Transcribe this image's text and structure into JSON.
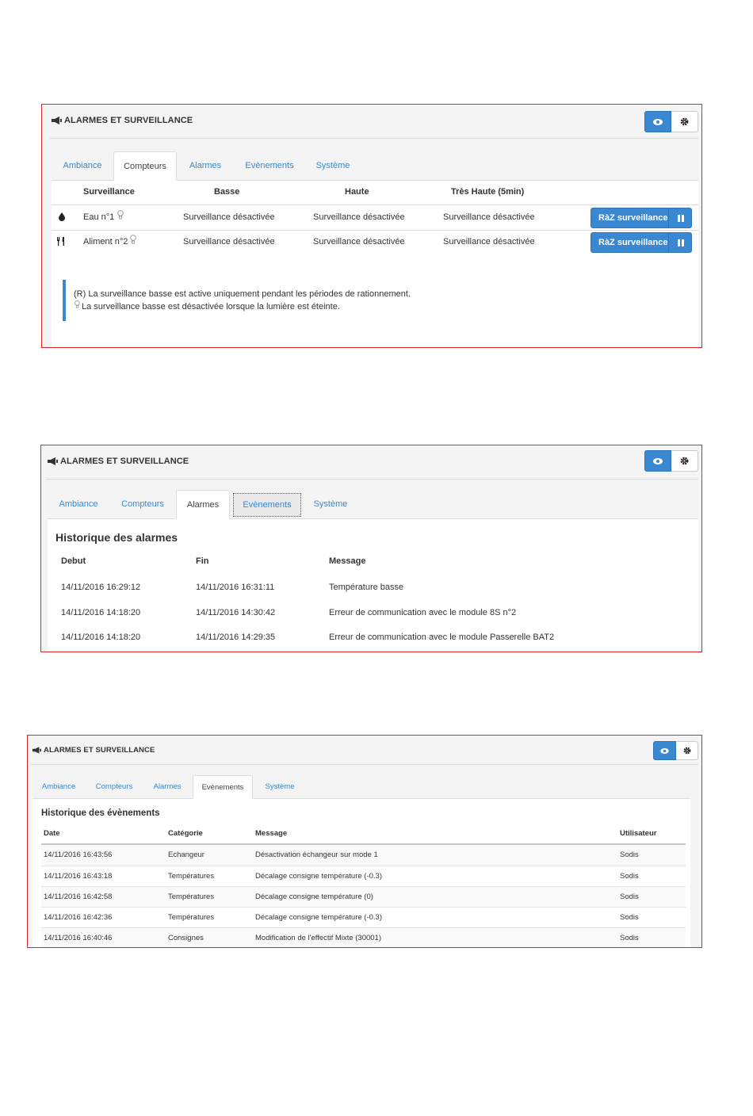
{
  "panel_title": "ALARMES ET SURVEILLANCE",
  "icons": {
    "megaphone": "megaphone-icon",
    "eye": "eye-icon",
    "gear": "gear-icon",
    "water": "water-drop-icon",
    "food": "cutlery-icon",
    "bulb": "lightbulb-icon",
    "pause": "pause-icon"
  },
  "colors": {
    "accent": "#3a87d2",
    "frame": "#e0262b"
  },
  "tabs": [
    "Ambiance",
    "Compteurs",
    "Alarmes",
    "Evènements",
    "Système"
  ],
  "compteurs": {
    "active_tab": "Compteurs",
    "headers": [
      "Surveillance",
      "Basse",
      "Haute",
      "Très Haute (5min)"
    ],
    "rows": [
      {
        "name": "Eau n°1",
        "basse": "Surveillance désactivée",
        "haute": "Surveillance désactivée",
        "tres_haute": "Surveillance désactivée",
        "button": "RàZ surveillance"
      },
      {
        "name": "Aliment n°2",
        "basse": "Surveillance désactivée",
        "haute": "Surveillance désactivée",
        "tres_haute": "Surveillance désactivée",
        "button": "RàZ surveillance"
      }
    ],
    "note_line1": "(R) La surveillance basse est active uniquement pendant les périodes de rationnement.",
    "note_line2": "La surveillance basse est désactivée lorsque la lumière est éteinte."
  },
  "alarmes": {
    "active_tab": "Alarmes",
    "focused_tab": "Evènements",
    "title": "Historique des alarmes",
    "headers": [
      "Debut",
      "Fin",
      "Message"
    ],
    "rows": [
      [
        "14/11/2016 16:29:12",
        "14/11/2016 16:31:11",
        "Température basse"
      ],
      [
        "14/11/2016 14:18:20",
        "14/11/2016 14:30:42",
        "Erreur de communication avec le module 8S n°2"
      ],
      [
        "14/11/2016 14:18:20",
        "14/11/2016 14:29:35",
        "Erreur de communication avec le module Passerelle BAT2"
      ]
    ]
  },
  "evenements": {
    "active_tab": "Evènements",
    "title": "Historique des évènements",
    "headers": [
      "Date",
      "Catégorie",
      "Message",
      "Utilisateur"
    ],
    "rows": [
      [
        "14/11/2016 16:43:56",
        "Echangeur",
        "Désactivation échangeur sur mode 1",
        "Sodis"
      ],
      [
        "14/11/2016 16:43:18",
        "Températures",
        "Décalage consigne température (-0.3)",
        "Sodis"
      ],
      [
        "14/11/2016 16:42:58",
        "Températures",
        "Décalage consigne température (0)",
        "Sodis"
      ],
      [
        "14/11/2016 16:42:36",
        "Températures",
        "Décalage consigne température (-0.3)",
        "Sodis"
      ],
      [
        "14/11/2016 16:40:46",
        "Consignes",
        "Modification de l'effectif Mixte (30001)",
        "Sodis"
      ]
    ]
  }
}
